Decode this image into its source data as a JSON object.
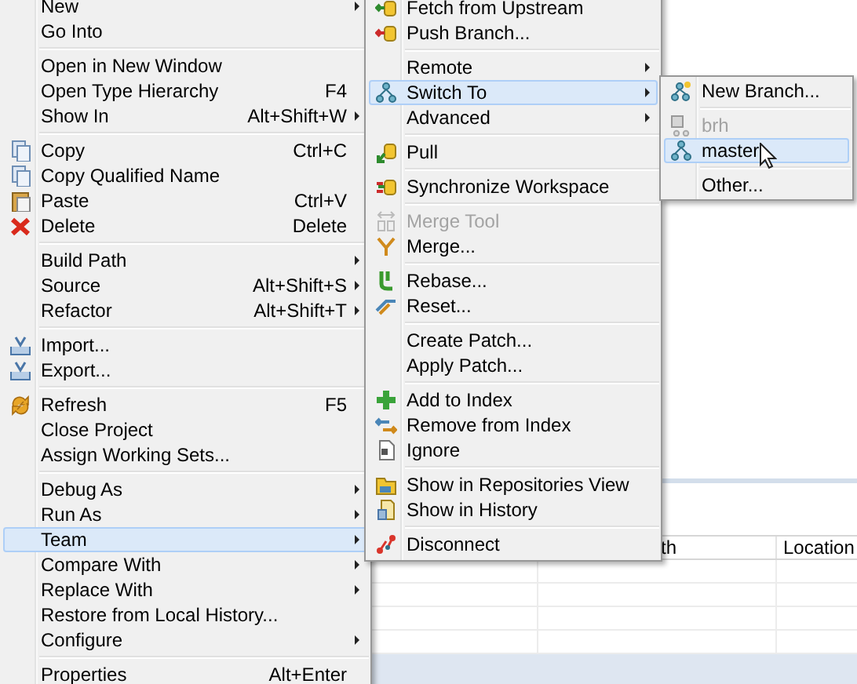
{
  "menus": [
    {
      "groups": [
        {
          "items": [
            {
              "label": "New",
              "submenu": true,
              "disabled": false,
              "selected": false
            },
            {
              "label": "Go Into",
              "submenu": false,
              "disabled": false,
              "selected": false
            }
          ]
        },
        {
          "items": [
            {
              "label": "Open in New Window",
              "submenu": false,
              "disabled": false,
              "selected": false
            },
            {
              "label": "Open Type Hierarchy",
              "shortcut": "F4",
              "submenu": false,
              "disabled": false,
              "selected": false
            },
            {
              "label": "Show In",
              "shortcut": "Alt+Shift+W",
              "submenu": true,
              "disabled": false,
              "selected": false
            }
          ]
        },
        {
          "items": [
            {
              "label": "Copy",
              "shortcut": "Ctrl+C",
              "submenu": false,
              "disabled": false,
              "selected": false
            },
            {
              "label": "Copy Qualified Name",
              "submenu": false,
              "disabled": false,
              "selected": false
            },
            {
              "label": "Paste",
              "shortcut": "Ctrl+V",
              "submenu": false,
              "disabled": false,
              "selected": false
            },
            {
              "label": "Delete",
              "shortcut": "Delete",
              "submenu": false,
              "disabled": false,
              "selected": false
            }
          ]
        },
        {
          "items": [
            {
              "label": "Build Path",
              "submenu": true,
              "disabled": false,
              "selected": false
            },
            {
              "label": "Source",
              "shortcut": "Alt+Shift+S",
              "submenu": true,
              "disabled": false,
              "selected": false
            },
            {
              "label": "Refactor",
              "shortcut": "Alt+Shift+T",
              "submenu": true,
              "disabled": false,
              "selected": false
            }
          ]
        },
        {
          "items": [
            {
              "label": "Import...",
              "submenu": false,
              "disabled": false,
              "selected": false
            },
            {
              "label": "Export...",
              "submenu": false,
              "disabled": false,
              "selected": false
            }
          ]
        },
        {
          "items": [
            {
              "label": "Refresh",
              "shortcut": "F5",
              "submenu": false,
              "disabled": false,
              "selected": false
            },
            {
              "label": "Close Project",
              "submenu": false,
              "disabled": false,
              "selected": false
            },
            {
              "label": "Assign Working Sets...",
              "submenu": false,
              "disabled": false,
              "selected": false
            }
          ]
        },
        {
          "items": [
            {
              "label": "Debug As",
              "submenu": true,
              "disabled": false,
              "selected": false
            },
            {
              "label": "Run As",
              "submenu": true,
              "disabled": false,
              "selected": false
            },
            {
              "label": "Team",
              "submenu": true,
              "disabled": false,
              "selected": true
            },
            {
              "label": "Compare With",
              "submenu": true,
              "disabled": false,
              "selected": false
            },
            {
              "label": "Replace With",
              "submenu": true,
              "disabled": false,
              "selected": false
            },
            {
              "label": "Restore from Local History...",
              "submenu": false,
              "disabled": false,
              "selected": false
            },
            {
              "label": "Configure",
              "submenu": true,
              "disabled": false,
              "selected": false
            }
          ]
        },
        {
          "items": [
            {
              "label": "Properties",
              "shortcut": "Alt+Enter",
              "submenu": false,
              "disabled": false,
              "selected": false
            }
          ]
        }
      ]
    },
    {
      "groups": [
        {
          "items": [
            {
              "label": "Fetch from Upstream",
              "submenu": false,
              "disabled": false,
              "selected": false
            },
            {
              "label": "Push Branch...",
              "submenu": false,
              "disabled": false,
              "selected": false
            }
          ]
        },
        {
          "items": [
            {
              "label": "Remote",
              "submenu": true,
              "disabled": false,
              "selected": false
            },
            {
              "label": "Switch To",
              "submenu": true,
              "disabled": false,
              "selected": true
            },
            {
              "label": "Advanced",
              "submenu": true,
              "disabled": false,
              "selected": false
            }
          ]
        },
        {
          "items": [
            {
              "label": "Pull",
              "submenu": false,
              "disabled": false,
              "selected": false
            }
          ]
        },
        {
          "items": [
            {
              "label": "Synchronize Workspace",
              "submenu": false,
              "disabled": false,
              "selected": false
            }
          ]
        },
        {
          "items": [
            {
              "label": "Merge Tool",
              "submenu": false,
              "disabled": true,
              "selected": false
            },
            {
              "label": "Merge...",
              "submenu": false,
              "disabled": false,
              "selected": false
            }
          ]
        },
        {
          "items": [
            {
              "label": "Rebase...",
              "submenu": false,
              "disabled": false,
              "selected": false
            },
            {
              "label": "Reset...",
              "submenu": false,
              "disabled": false,
              "selected": false
            }
          ]
        },
        {
          "items": [
            {
              "label": "Create Patch...",
              "submenu": false,
              "disabled": false,
              "selected": false
            },
            {
              "label": "Apply Patch...",
              "submenu": false,
              "disabled": false,
              "selected": false
            }
          ]
        },
        {
          "items": [
            {
              "label": "Add to Index",
              "submenu": false,
              "disabled": false,
              "selected": false
            },
            {
              "label": "Remove from Index",
              "submenu": false,
              "disabled": false,
              "selected": false
            },
            {
              "label": "Ignore",
              "submenu": false,
              "disabled": false,
              "selected": false
            }
          ]
        },
        {
          "items": [
            {
              "label": "Show in Repositories View",
              "submenu": false,
              "disabled": false,
              "selected": false
            },
            {
              "label": "Show in History",
              "submenu": false,
              "disabled": false,
              "selected": false
            }
          ]
        },
        {
          "items": [
            {
              "label": "Disconnect",
              "submenu": false,
              "disabled": false,
              "selected": false
            }
          ]
        }
      ]
    },
    {
      "groups": [
        {
          "items": [
            {
              "label": "New Branch...",
              "submenu": false,
              "disabled": false,
              "selected": false
            }
          ]
        },
        {
          "items": [
            {
              "label": "brh",
              "submenu": false,
              "disabled": true,
              "selected": false
            },
            {
              "label": "master",
              "submenu": false,
              "disabled": false,
              "selected": true
            }
          ]
        },
        {
          "items": [
            {
              "label": "Other...",
              "submenu": false,
              "disabled": false,
              "selected": false
            }
          ]
        }
      ]
    }
  ],
  "table": {
    "columns": [
      "th",
      "Location"
    ]
  }
}
